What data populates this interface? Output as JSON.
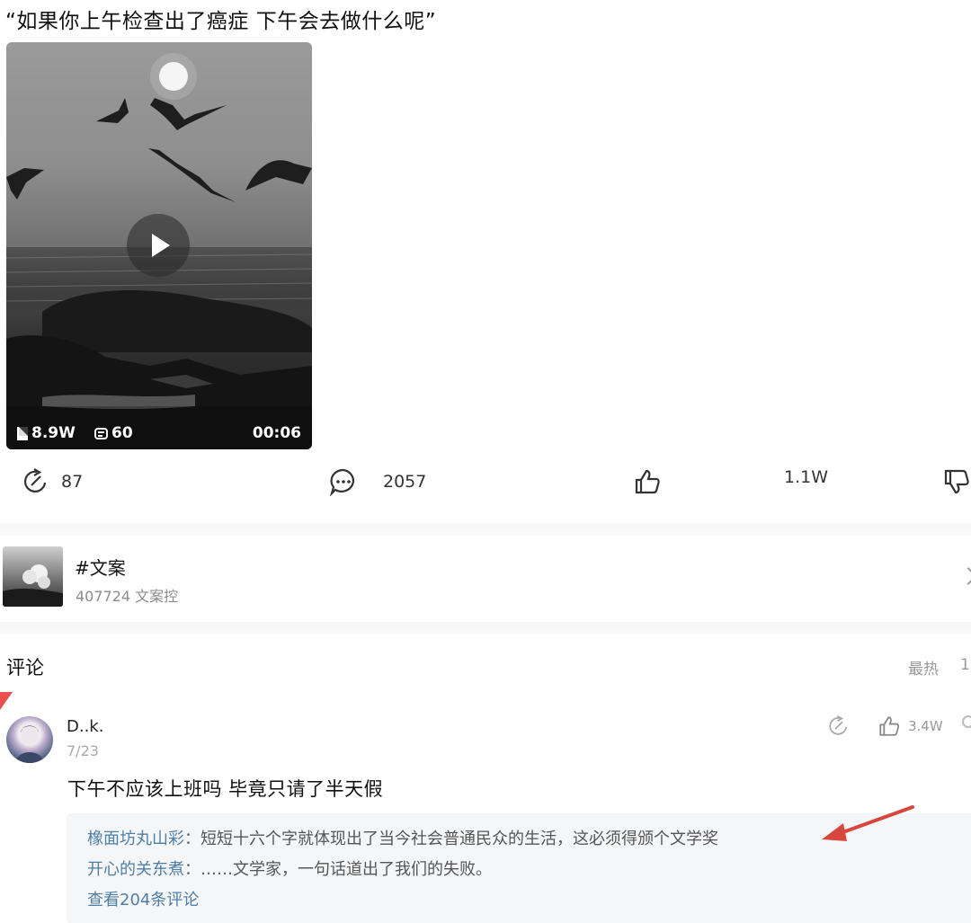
{
  "post": {
    "title": "“如果你上午检查出了癌症 下午会去做什么呢”"
  },
  "video": {
    "views": "8.9W",
    "danmu": "60",
    "duration": "00:06"
  },
  "actions": {
    "share_count": "87",
    "comment_count": "2057",
    "like_count": "1.1W"
  },
  "topic": {
    "name": "#文案",
    "meta": "407724 文案控"
  },
  "comments": {
    "heading": "评论",
    "sort_label": "最热",
    "sort_extra": "1",
    "items": [
      {
        "author": "D..k.",
        "date": "7/23",
        "like_count": "3.4W",
        "text": "下午不应该上班吗    毕竟只请了半天假",
        "replies": [
          {
            "author": "橡面坊丸山彩",
            "text": "短短十六个字就体现出了当今社会普通民众的生活，这必须得颁个文学奖"
          },
          {
            "author": "开心的关东煮",
            "text": "……文学家，一句话道出了我们的失败。"
          }
        ],
        "view_all": "查看204条评论"
      }
    ]
  },
  "colors": {
    "link_blue": "#4e7fa8",
    "annotation_red": "#d9463e"
  }
}
